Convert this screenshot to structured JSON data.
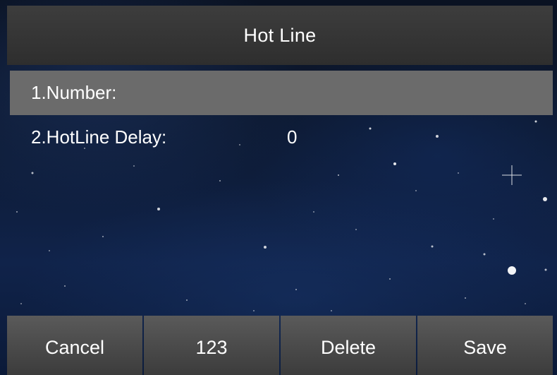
{
  "screen": {
    "title": "Hot Line"
  },
  "fields": [
    {
      "label": "1.Number:",
      "value": "",
      "selected": true
    },
    {
      "label": "2.HotLine Delay:",
      "value": "0",
      "selected": false
    }
  ],
  "softkeys": {
    "cancel": "Cancel",
    "input_mode": "123",
    "delete": "Delete",
    "save": "Save"
  },
  "colors": {
    "titlebar": "#363636",
    "selected_row": "#6b6b6b",
    "softkey": "#4a4a4a",
    "text": "#ffffff"
  }
}
